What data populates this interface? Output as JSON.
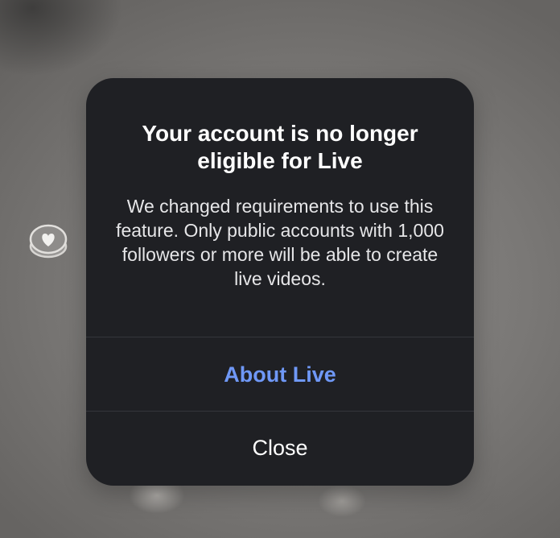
{
  "background": {
    "reaction_icon": "heart-reaction-icon"
  },
  "dialog": {
    "title": "Your account is no longer eligible for Live",
    "message": "We changed requirements to use this feature. Only public accounts with 1,000 followers or more will be able to create live videos.",
    "primary_action": "About Live",
    "secondary_action": "Close"
  },
  "colors": {
    "dialog_bg": "#1f2024",
    "primary_action": "#6f98f7",
    "title_text": "#ffffff",
    "divider": "#34363b"
  }
}
